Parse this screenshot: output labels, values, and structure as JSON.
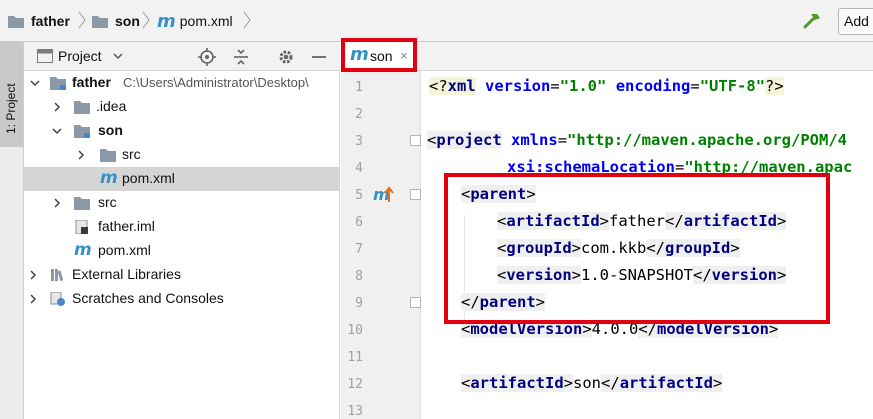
{
  "breadcrumbs": [
    {
      "label": "father"
    },
    {
      "label": "son"
    },
    {
      "label": "pom.xml"
    }
  ],
  "nav": {
    "add_label": "Add"
  },
  "toolwindow_strip": {
    "tab_label": "1: Project"
  },
  "project_panel": {
    "title": "Project"
  },
  "tree": [
    {
      "label": "father",
      "path": "C:\\Users\\Administrator\\Desktop\\"
    },
    {
      "label": ".idea"
    },
    {
      "label": "son"
    },
    {
      "label": "src"
    },
    {
      "label": "pom.xml"
    },
    {
      "label": "src"
    },
    {
      "label": "father.iml"
    },
    {
      "label": "pom.xml"
    },
    {
      "label": "External Libraries"
    },
    {
      "label": "Scratches and Consoles"
    }
  ],
  "editor_tab": {
    "label": "son",
    "close": "×"
  },
  "maven_glyph": "m",
  "line_numbers": [
    "1",
    "2",
    "3",
    "4",
    "5",
    "6",
    "7",
    "8",
    "9",
    "10",
    "11",
    "12",
    "13"
  ],
  "code": {
    "l1_open": "<?",
    "l1_name": "xml",
    "l1_a1": "version",
    "l1_eq1": "=",
    "l1_v1": "\"1.0\"",
    "l1_a2": "encoding",
    "l1_eq2": "=",
    "l1_v2": "\"UTF-8\"",
    "l1_close": "?>",
    "l3_open": "<",
    "l3_tag": "project",
    "l3_attr": "xmlns",
    "l3_eq": "=",
    "l3_val": "\"http://maven.apache.org/POM/4",
    "l4_attr": "xsi:schemaLocation",
    "l4_eq": "=",
    "l4_val": "\"http://maven.apac",
    "l5_tag": "parent",
    "l6_tag": "artifactId",
    "l6_text": "father",
    "l7_tag": "groupId",
    "l7_text": "com.kkb",
    "l8_tag": "version",
    "l8_text": "1.0-SNAPSHOT",
    "l9_tag": "parent",
    "l10_tag": "modelVersion",
    "l10_text": "4.0.0",
    "l12_tag": "artifactId",
    "l12_text": "son"
  },
  "colors": {
    "tag": "#000080",
    "attribute": "#0000ff",
    "string": "#008000",
    "highlight_frame": "#e0000f",
    "maven_blue": "#3592c4"
  }
}
